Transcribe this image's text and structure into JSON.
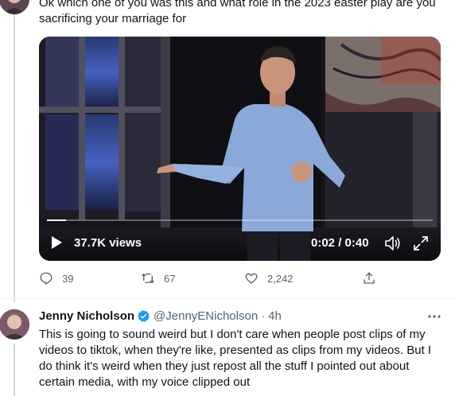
{
  "tweet1": {
    "text_line1": "Ok which one of you was this and what role in the 2023 easter play are you",
    "text_line2": "sacrificing your marriage for",
    "video": {
      "views": "37.7K views",
      "time": "0:02 / 0:40",
      "progress": 0.05,
      "play_icon": "play-icon",
      "volume_icon": "volume-icon",
      "fullscreen_icon": "fullscreen-icon"
    },
    "actions": {
      "replies": "39",
      "retweets": "67",
      "likes": "2,242"
    }
  },
  "tweet2": {
    "name": "Jenny Nicholson",
    "handle": "@JennyENicholson",
    "separator": "·",
    "time": "4h",
    "more_icon": "more-icon",
    "text_lines": [
      "This is going to sound weird but I don't care when people post clips of my",
      "videos to tiktok, when they're like, presented as clips from my videos. But I",
      "do think it's weird when they just repost all the stuff I pointed out about",
      "certain media, with my voice clipped out"
    ]
  },
  "colors": {
    "text": "#0f1419",
    "secondary": "#536471",
    "verified": "#1d9bf0",
    "thread_line": "#cfd9de"
  }
}
